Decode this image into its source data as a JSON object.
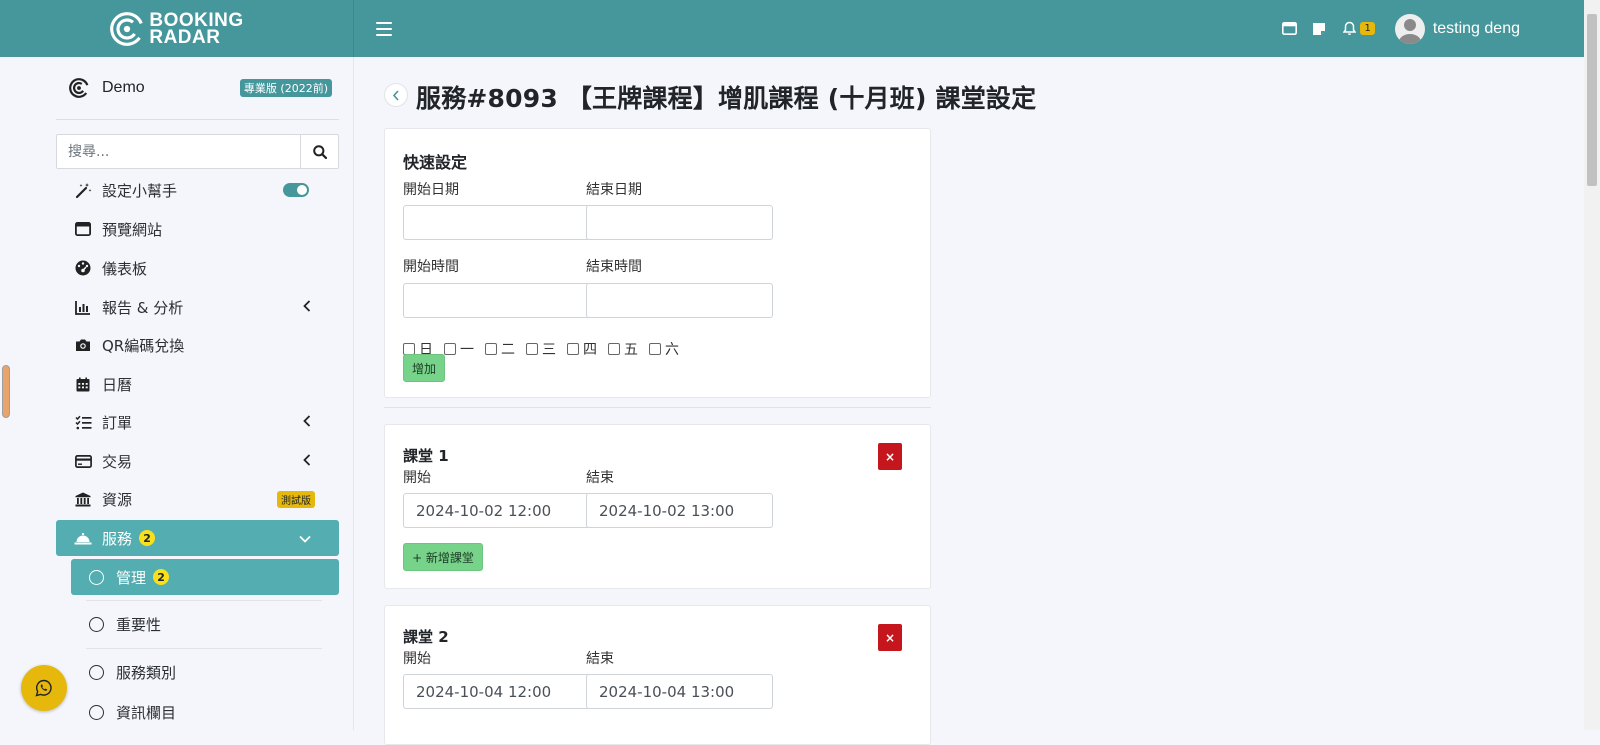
{
  "header": {
    "brand_line1": "BOOKING",
    "brand_line2": "RADAR",
    "notification_count": "1",
    "user_name": "testing deng"
  },
  "sidebar": {
    "tenant_name": "Demo",
    "plan_badge": "專業版 (2022前)",
    "search_placeholder": "搜尋...",
    "items": [
      {
        "label": "設定小幫手",
        "icon": "magic-wand-icon"
      },
      {
        "label": "預覽網站",
        "icon": "browser-window-icon"
      },
      {
        "label": "儀表板",
        "icon": "dashboard-gauge-icon"
      },
      {
        "label": "報告 & 分析",
        "icon": "bar-chart-icon"
      },
      {
        "label": "QR編碼兌換",
        "icon": "camera-icon"
      },
      {
        "label": "日曆",
        "icon": "calendar-icon"
      },
      {
        "label": "訂單",
        "icon": "checklist-icon"
      },
      {
        "label": "交易",
        "icon": "credit-card-icon"
      },
      {
        "label": "資源",
        "icon": "bank-icon",
        "badge": "測試版"
      },
      {
        "label": "服務",
        "icon": "service-bell-icon",
        "count": "2"
      }
    ],
    "sub_items": [
      {
        "label": "管理",
        "count": "2"
      },
      {
        "label": "重要性"
      },
      {
        "label": "服務類別"
      },
      {
        "label": "資訊欄目"
      }
    ]
  },
  "page": {
    "title": "服務#8093 【王牌課程】增肌課程 (十月班) 課堂設定"
  },
  "quick": {
    "title": "快速設定",
    "start_date_label": "開始日期",
    "end_date_label": "結束日期",
    "start_time_label": "開始時間",
    "end_time_label": "結束時間",
    "days": [
      "日",
      "一",
      "二",
      "三",
      "四",
      "五",
      "六"
    ],
    "add_button": "增加"
  },
  "sessions": [
    {
      "title": "課堂 1",
      "start_label": "開始",
      "end_label": "結束",
      "start": "2024-10-02 12:00",
      "end": "2024-10-02 13:00"
    },
    {
      "title": "課堂 2",
      "start_label": "開始",
      "end_label": "結束",
      "start": "2024-10-04 12:00",
      "end": "2024-10-04 13:00"
    }
  ],
  "add_session_button": "+ 新增課堂",
  "delete_button": "×",
  "colors": {
    "header": "#45979c",
    "active": "#54adb1",
    "danger": "#c4161c",
    "success": "#77d28a",
    "badge": "#e6b80c"
  }
}
